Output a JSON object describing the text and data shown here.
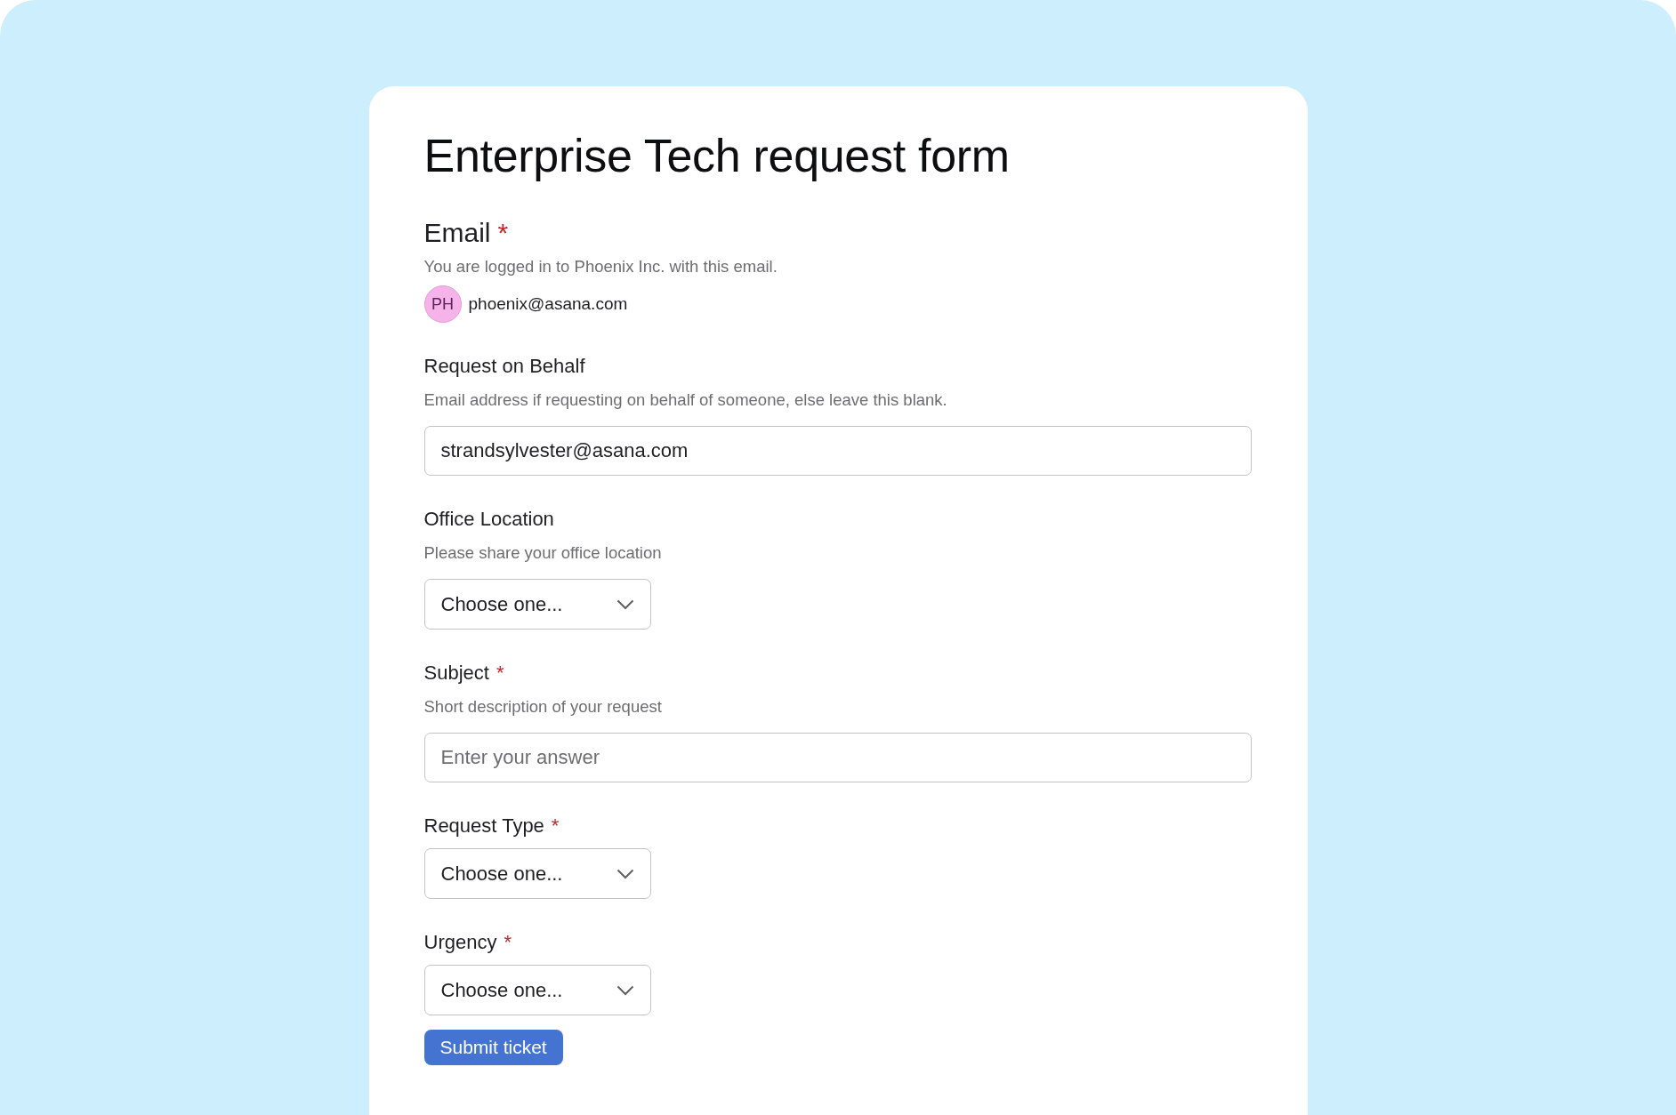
{
  "form": {
    "title": "Enterprise Tech request form",
    "fields": [
      {
        "kind": "account",
        "label": "Email",
        "required_mark": "*",
        "description": "You are logged in to Phoenix Inc. with this email.",
        "avatar": {
          "initials": "PH",
          "color": "#f5b3ea"
        },
        "value": "phoenix@asana.com"
      },
      {
        "kind": "text",
        "label": "Request on Behalf",
        "description": "Email address if requesting on behalf of someone, else leave this blank.",
        "value": "strandsylvester@asana.com"
      },
      {
        "kind": "select",
        "label": "Office Location",
        "description": "Please share your office location",
        "value": "Choose one..."
      },
      {
        "kind": "text",
        "label": "Subject",
        "required_mark": "*",
        "description": "Short description of your request",
        "placeholder": "Enter your answer"
      },
      {
        "kind": "select",
        "label": "Request Type",
        "required_mark": "*",
        "value": "Choose one..."
      },
      {
        "kind": "select",
        "label": "Urgency",
        "required_mark": "*",
        "value": "Choose one..."
      }
    ],
    "submit": "Submit ticket"
  }
}
